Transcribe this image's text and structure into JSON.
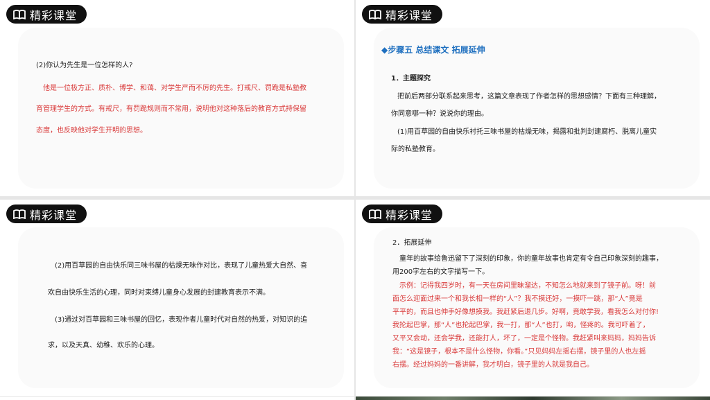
{
  "badge_label": "精彩课堂",
  "slide1": {
    "question": "(2)你认为先生是一位怎样的人?",
    "answer_lines": [
      "他是一位极方正、质朴、博学、和蔼、对学生严而不厉的先生。打戒尺、罚跪是私塾教",
      "育管理学生的方式。有戒尺，有罚跪规则而不常用，说明他对这种落后的教育方式持保留",
      "态度，也反映他对学生开明的思想。"
    ]
  },
  "slide2": {
    "heading": "◆步骤五  总结课文  拓展延伸",
    "section": "1．主题探究",
    "lines": [
      "把前后两部分联系起来思考，这篇文章表现了作者怎样的思想感情？下面有三种理解，",
      "你同意哪一种？说说你的理由。",
      "(1)用百草园的自由快乐衬托三味书屋的枯燥无味，揭露和批判封建腐朽、脱离儿童实",
      "际的私塾教育。"
    ]
  },
  "slide3": {
    "lines": [
      "(2)用百草园的自由快乐同三味书屋的枯燥无味作对比，表现了儿童热爱大自然、喜",
      "欢自由快乐生活的心理，同时对束缚儿童身心发展的封建教育表示不满。",
      "(3)通过对百草园和三味书屋的回忆，表现作者儿童时代对自然的热爱，对知识的追",
      "求，以及天真、幼稚、欢乐的心理。"
    ]
  },
  "slide4": {
    "section": "2．拓展延伸",
    "lines": [
      "童年的故事给鲁迅留下了深刻的印象，你的童年故事也肯定有令自己印象深刻的趣事，",
      "用200字左右的文字描写一下。"
    ],
    "example_lines": [
      "示例：记得我四岁时，有一天在房间里昧溜达，不知怎么地就来到了镜子前。呀！前",
      "面怎么迎面过来一个和我长相一样的“人”？我不摸还好，一摸吓一跳，那“人”竟是",
      "平平的，而且也伸手好像想摸我。我赶紧后退几步。好啊，竟敢学我，看我怎么对付你!",
      "我抡起巴掌，那“人”也抡起巴掌，我一打，那“人”也打，哟，怪疼的。我可吓着了，",
      "又平又会动，还会学我，还能打人，坏了，一定是个怪物。我赶紧叫来妈妈，妈妈告诉",
      "我：“这是镜子，根本不是什么怪物，你看。”只见妈妈左摇右摆，镜子里的人也左摇",
      "右摆。经过妈妈的一番讲解，我才明白，镜子里的人就是我自己。"
    ]
  }
}
